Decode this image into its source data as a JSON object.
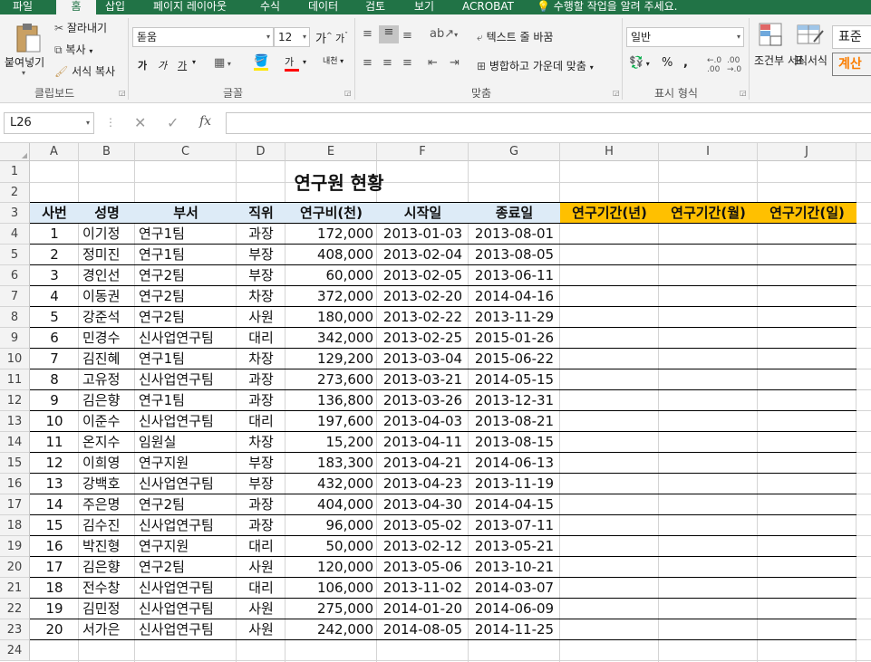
{
  "menu_tabs": [
    "파일",
    "홈",
    "삽입",
    "페이지 레이아웃",
    "수식",
    "데이터",
    "검토",
    "보기",
    "ACROBAT",
    "수행할 작업을 알려 주세요."
  ],
  "ribbon": {
    "clipboard": {
      "paste": "붙여넣기",
      "cut": "잘라내기",
      "copy": "복사",
      "format_painter": "서식 복사",
      "group": "클립보드"
    },
    "font": {
      "name": "돋움",
      "size": "12",
      "bold": "가",
      "italic": "가",
      "underline": "가",
      "group": "글꼴",
      "color_letter": "가",
      "phonetic": "내천"
    },
    "align": {
      "wrap": "텍스트 줄 바꿈",
      "merge": "병합하고 가운데 맞춤",
      "group": "맞춤"
    },
    "number": {
      "format": "일반",
      "percent": "%",
      "comma": ",",
      "group": "표시 형식"
    },
    "styles": {
      "conditional": "조건부 서식",
      "table": "표 서식",
      "normal": "표준",
      "calc": "계산"
    }
  },
  "formula_bar": {
    "name_box": "L26",
    "fx": "fx",
    "formula": ""
  },
  "columns": [
    "A",
    "B",
    "C",
    "D",
    "E",
    "F",
    "G",
    "H",
    "I",
    "J"
  ],
  "rows": [
    "1",
    "2",
    "3",
    "4",
    "5",
    "6",
    "7",
    "8",
    "9",
    "10",
    "11",
    "12",
    "13",
    "14",
    "15",
    "16",
    "17",
    "18",
    "19",
    "20",
    "21",
    "22",
    "23",
    "24"
  ],
  "sheet": {
    "title": "연구원 현황",
    "headers": [
      "사번",
      "성명",
      "부서",
      "직위",
      "연구비(천)",
      "시작일",
      "종료일",
      "연구기간(년)",
      "연구기간(월)",
      "연구기간(일)"
    ],
    "data": [
      [
        "1",
        "이기정",
        "연구1팀",
        "과장",
        "172,000",
        "2013-01-03",
        "2013-08-01"
      ],
      [
        "2",
        "정미진",
        "연구1팀",
        "부장",
        "408,000",
        "2013-02-04",
        "2013-08-05"
      ],
      [
        "3",
        "경인선",
        "연구2팀",
        "부장",
        "60,000",
        "2013-02-05",
        "2013-06-11"
      ],
      [
        "4",
        "이동권",
        "연구2팀",
        "차장",
        "372,000",
        "2013-02-20",
        "2014-04-16"
      ],
      [
        "5",
        "강준석",
        "연구2팀",
        "사원",
        "180,000",
        "2013-02-22",
        "2013-11-29"
      ],
      [
        "6",
        "민경수",
        "신사업연구팀",
        "대리",
        "342,000",
        "2013-02-25",
        "2015-01-26"
      ],
      [
        "7",
        "김진혜",
        "연구1팀",
        "차장",
        "129,200",
        "2013-03-04",
        "2015-06-22"
      ],
      [
        "8",
        "고유정",
        "신사업연구팀",
        "과장",
        "273,600",
        "2013-03-21",
        "2014-05-15"
      ],
      [
        "9",
        "김은향",
        "연구1팀",
        "과장",
        "136,800",
        "2013-03-26",
        "2013-12-31"
      ],
      [
        "10",
        "이준수",
        "신사업연구팀",
        "대리",
        "197,600",
        "2013-04-03",
        "2013-08-21"
      ],
      [
        "11",
        "온지수",
        "임원실",
        "차장",
        "15,200",
        "2013-04-11",
        "2013-08-15"
      ],
      [
        "12",
        "이희영",
        "연구지원",
        "부장",
        "183,300",
        "2013-04-21",
        "2014-06-13"
      ],
      [
        "13",
        "강백호",
        "신사업연구팀",
        "부장",
        "432,000",
        "2013-04-23",
        "2013-11-19"
      ],
      [
        "14",
        "주은명",
        "연구2팀",
        "과장",
        "404,000",
        "2013-04-30",
        "2014-04-15"
      ],
      [
        "15",
        "김수진",
        "신사업연구팀",
        "과장",
        "96,000",
        "2013-05-02",
        "2013-07-11"
      ],
      [
        "16",
        "박진형",
        "연구지원",
        "대리",
        "50,000",
        "2013-02-12",
        "2013-05-21"
      ],
      [
        "17",
        "김은향",
        "연구2팀",
        "사원",
        "120,000",
        "2013-05-06",
        "2013-10-21"
      ],
      [
        "18",
        "전수창",
        "신사업연구팀",
        "대리",
        "106,000",
        "2013-11-02",
        "2014-03-07"
      ],
      [
        "19",
        "김민정",
        "신사업연구팀",
        "사원",
        "275,000",
        "2014-01-20",
        "2014-06-09"
      ],
      [
        "20",
        "서가은",
        "신사업연구팀",
        "사원",
        "242,000",
        "2014-08-05",
        "2014-11-25"
      ]
    ]
  },
  "colors": {
    "ribbon_green": "#217346",
    "header_blue": "#ddebf7",
    "header_orange": "#ffc000",
    "calc_orange": "#fa7d00"
  }
}
